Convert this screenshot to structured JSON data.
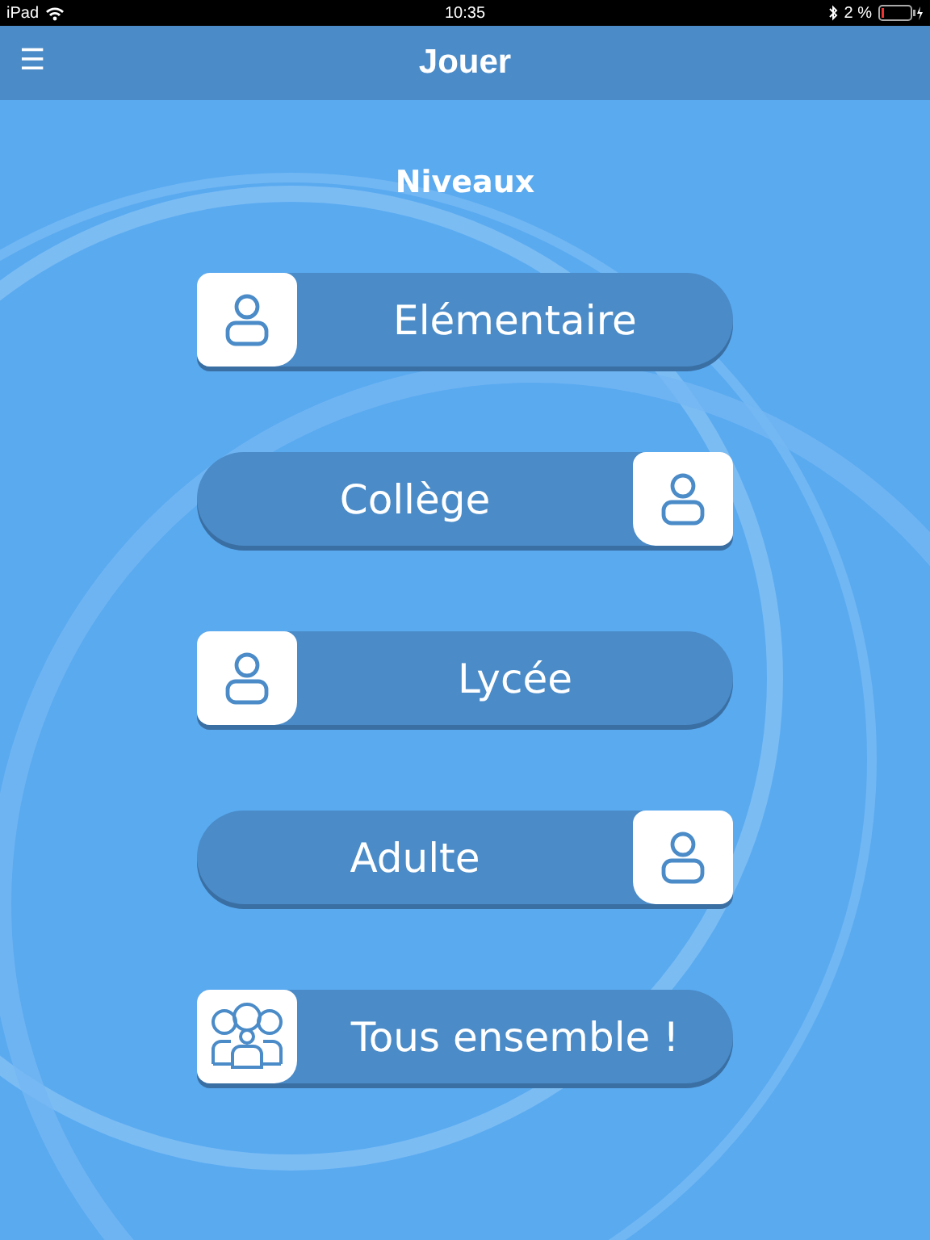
{
  "status_bar": {
    "device": "iPad",
    "time": "10:35",
    "battery": "2 %"
  },
  "header": {
    "menu_icon": "☰",
    "title": "Jouer"
  },
  "section_title": "Niveaux",
  "levels": [
    {
      "label": "Elémentaire",
      "kind": "single",
      "icon_right": false
    },
    {
      "label": "Collège",
      "kind": "single",
      "icon_right": true
    },
    {
      "label": "Lycée",
      "kind": "single",
      "icon_right": false
    },
    {
      "label": "Adulte",
      "kind": "single",
      "icon_right": true
    },
    {
      "label": "Tous ensemble !",
      "kind": "group",
      "icon_right": false
    }
  ]
}
